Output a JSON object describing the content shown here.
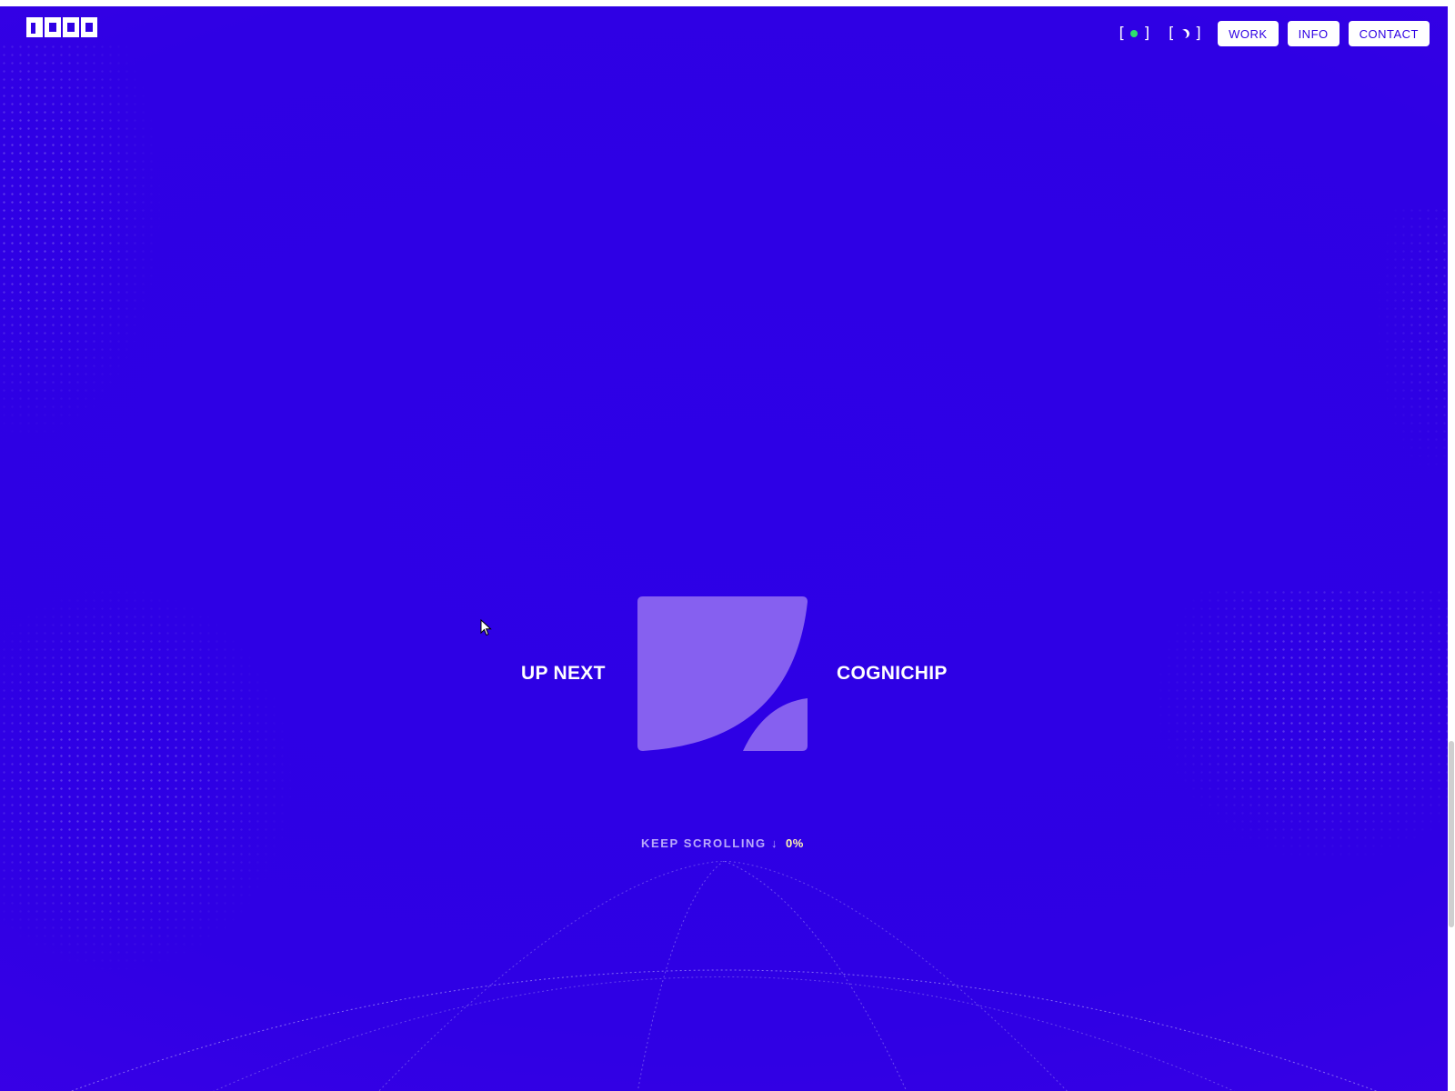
{
  "header": {
    "logo_name": "good-logo",
    "status_toggle": {
      "open": "[",
      "close": "]",
      "indicator_color": "#2ee06d"
    },
    "theme_toggle": {
      "open": "[",
      "close": "]"
    },
    "nav": [
      {
        "label": "WORK"
      },
      {
        "label": "INFO"
      },
      {
        "label": "CONTACT"
      }
    ]
  },
  "main": {
    "up_next_label": "UP NEXT",
    "project_name": "COGNICHIP",
    "card_color": "#8660f0"
  },
  "footer": {
    "scroll_label": "KEEP SCROLLING ↓",
    "scroll_progress": "0%"
  },
  "colors": {
    "background": "#2f00e4",
    "accent": "#ffffff",
    "card": "#8660f0"
  }
}
